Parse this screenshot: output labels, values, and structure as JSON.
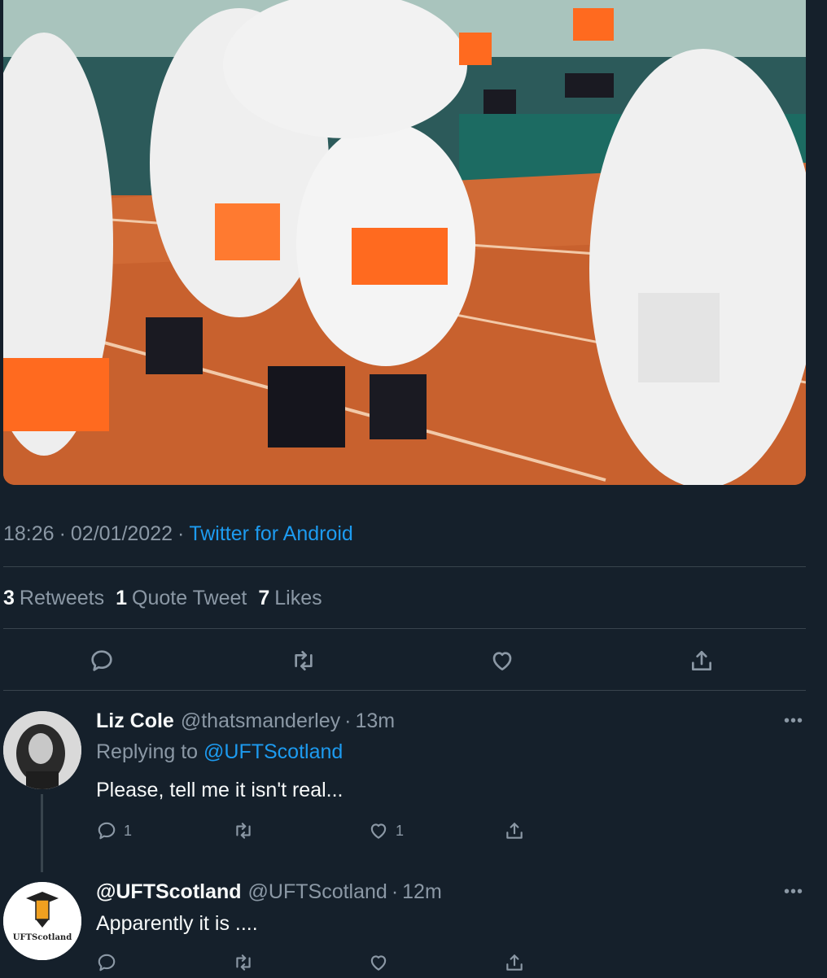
{
  "tweet": {
    "time": "18:26",
    "date": "02/01/2022",
    "source": "Twitter for Android",
    "separator": "·",
    "stats": [
      {
        "count": "3",
        "label": "Retweets"
      },
      {
        "count": "1",
        "label": "Quote Tweet"
      },
      {
        "count": "7",
        "label": "Likes"
      }
    ],
    "actions": [
      "reply-icon",
      "retweet-icon",
      "like-icon",
      "share-icon"
    ]
  },
  "replies": [
    {
      "name": "Liz Cole",
      "handle": "@thatsmanderley",
      "time": "13m",
      "replying_prefix": "Replying to",
      "replying_to": "@UFTScotland",
      "text": "Please, tell me it isn't real...",
      "reply_count": "1",
      "retweet_count": "",
      "like_count": "1",
      "more": "•••"
    },
    {
      "name": "@UFTScotland",
      "handle": "@UFTScotland",
      "time": "12m",
      "avatar_text": "UFTScotland",
      "text": "Apparently it is ....",
      "reply_count": "",
      "retweet_count": "",
      "like_count": "",
      "more": "•••"
    }
  ],
  "colors": {
    "background": "#15202b",
    "link": "#1d9bf0",
    "muted": "#8b98a5",
    "divider": "#38444d"
  }
}
